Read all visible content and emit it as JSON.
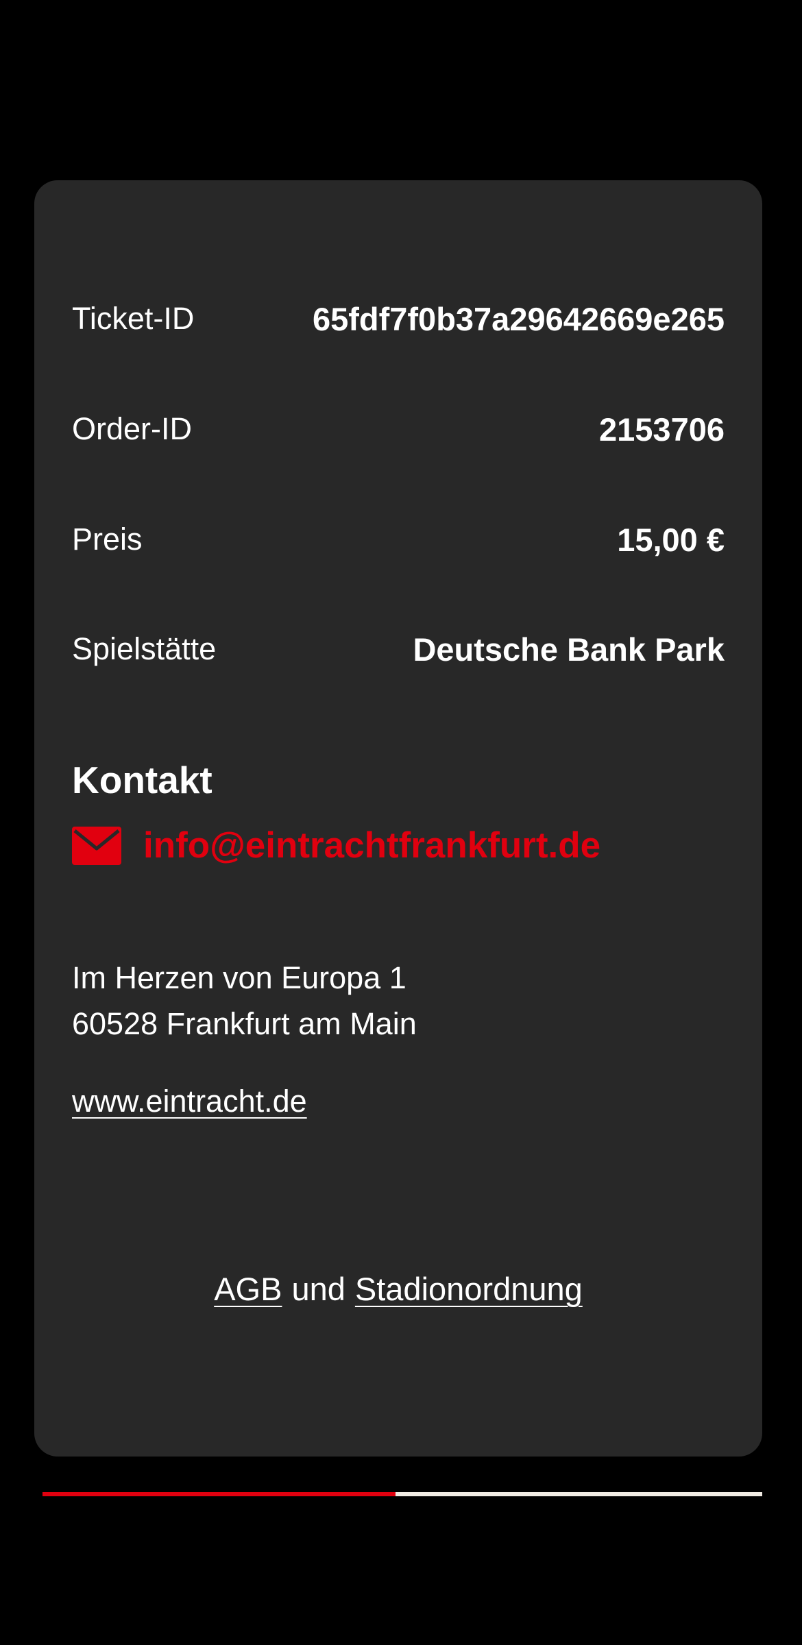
{
  "details": {
    "ticket_id_label": "Ticket-ID",
    "ticket_id_value": "65fdf7f0b37a29642669e265",
    "order_id_label": "Order-ID",
    "order_id_value": "2153706",
    "price_label": "Preis",
    "price_value": "15,00 €",
    "venue_label": "Spielstätte",
    "venue_value": "Deutsche Bank Park"
  },
  "contact": {
    "heading": "Kontakt",
    "email": "info@eintrachtfrankfurt.de",
    "email_icon": "mail-icon",
    "address_line1": "Im Herzen von Europa 1",
    "address_line2": "60528 Frankfurt am Main",
    "website": "www.eintracht.de"
  },
  "legal": {
    "agb_label": "AGB",
    "connector": "und",
    "stadium_rules_label": "Stadionordnung"
  },
  "progress": {
    "fraction": 0.49
  },
  "colors": {
    "accent": "#e1000f",
    "card_background": "#282828",
    "page_background": "#000000",
    "progress_track": "#f0ebe3"
  }
}
